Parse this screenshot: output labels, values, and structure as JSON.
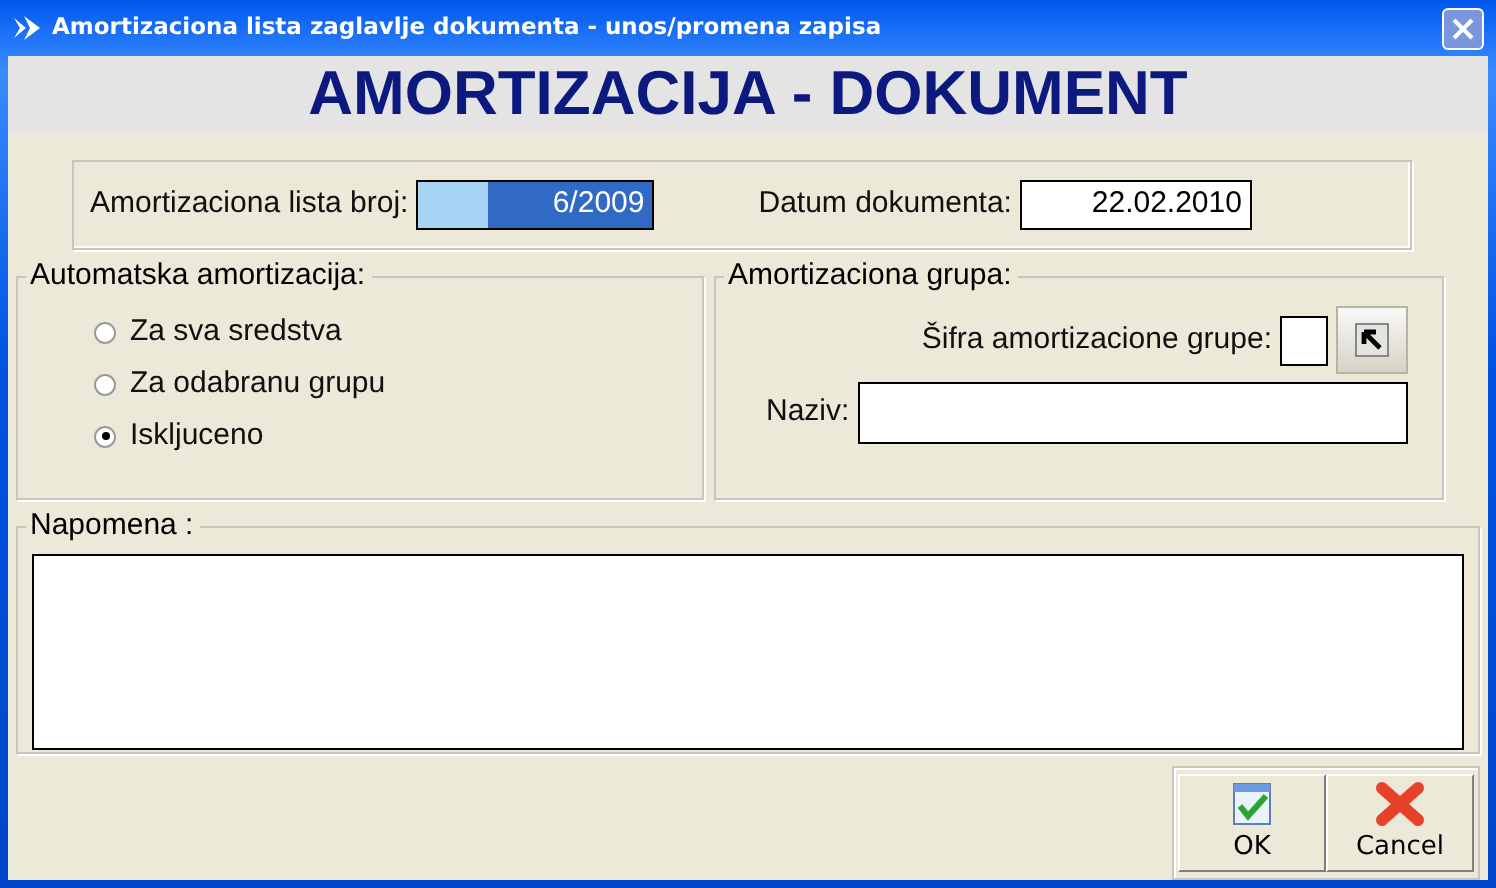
{
  "window": {
    "title": "Amortizaciona lista zaglavlje dokumenta - unos/promena zapisa"
  },
  "heading": "AMORTIZACIJA - DOKUMENT",
  "document": {
    "number_label": "Amortizaciona lista broj:",
    "number_value": "6/2009",
    "date_label": "Datum dokumenta:",
    "date_value": "22.02.2010"
  },
  "auto_depreciation": {
    "legend": "Automatska amortizacija:",
    "options": [
      {
        "label": "Za sva sredstva",
        "selected": false
      },
      {
        "label": "Za odabranu grupu",
        "selected": false
      },
      {
        "label": "Iskljuceno",
        "selected": true
      }
    ]
  },
  "group": {
    "legend": "Amortizaciona grupa:",
    "code_label": "Šifra amortizacione grupe:",
    "name_label": "Naziv:"
  },
  "note": {
    "legend": "Napomena :"
  },
  "buttons": [
    {
      "kind": "ok",
      "label": "OK"
    },
    {
      "kind": "cancel",
      "label": "Cancel"
    }
  ]
}
